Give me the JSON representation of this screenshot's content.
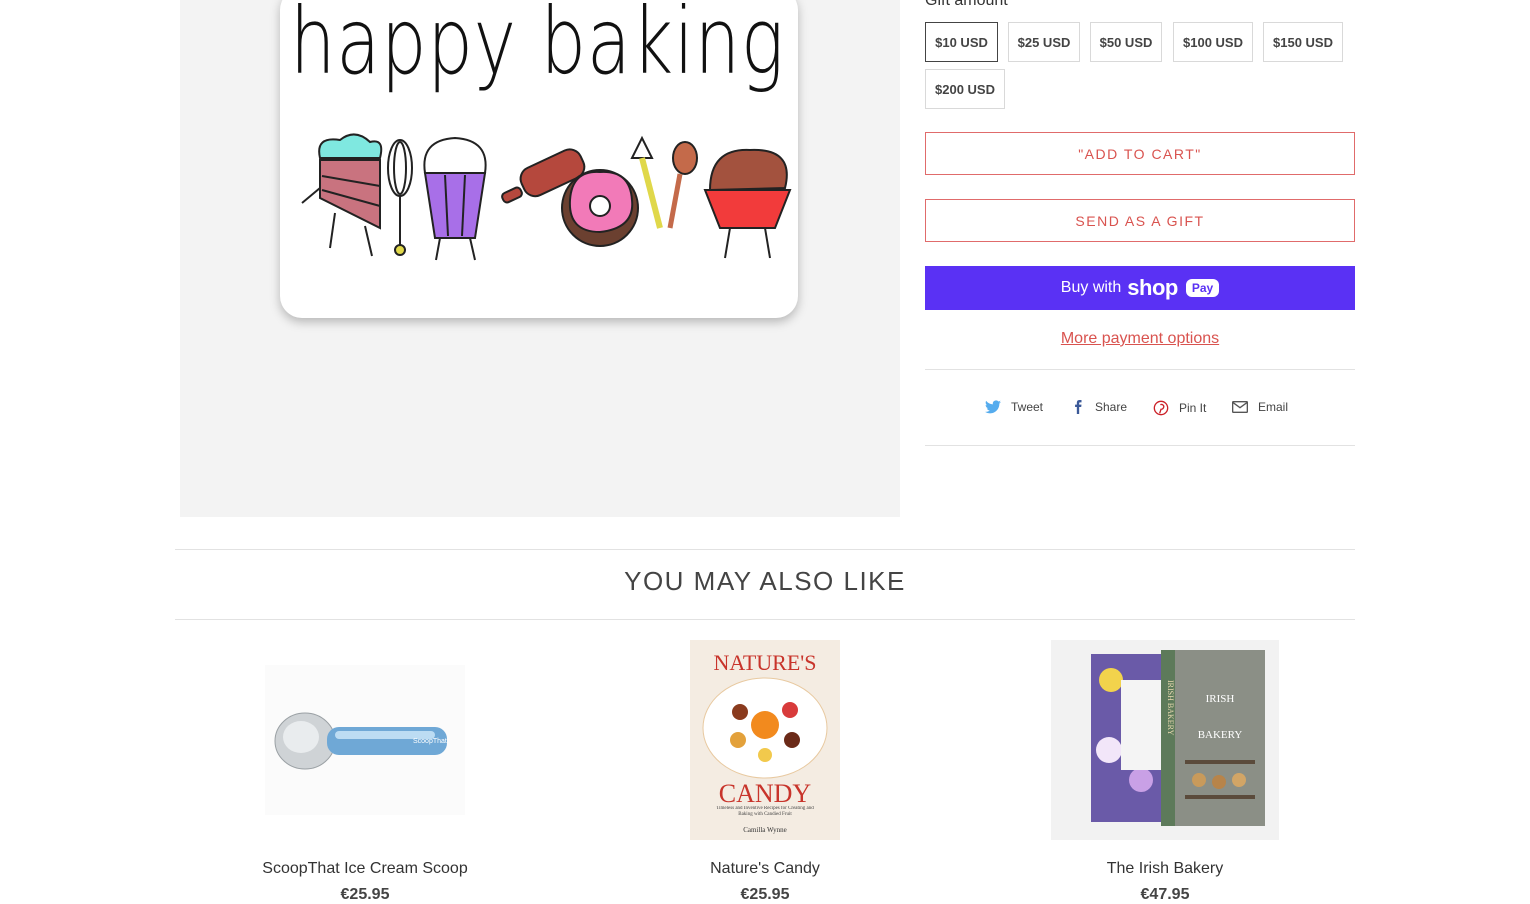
{
  "product_image": {
    "card_text": "happy baking"
  },
  "gift_amount": {
    "label": "Gift amount",
    "options": [
      "$10 USD",
      "$25 USD",
      "$50 USD",
      "$100 USD",
      "$150 USD",
      "$200 USD"
    ],
    "selected": "$10 USD"
  },
  "buttons": {
    "add_to_cart": "\"ADD TO CART\"",
    "send_as_gift": "SEND AS A GIFT",
    "buy_with": "Buy with",
    "shop_word": "shop",
    "pay_word": "Pay",
    "more_payment": "More payment options"
  },
  "social": {
    "tweet": "Tweet",
    "share": "Share",
    "pin": "Pin It",
    "email": "Email"
  },
  "related": {
    "title": "YOU MAY ALSO LIKE",
    "products": [
      {
        "name": "ScoopThat Ice Cream Scoop",
        "price": "€25.95",
        "image_text": "ScoopThat"
      },
      {
        "name": "Nature's Candy",
        "price": "€25.95",
        "image_title_top": "NATURE'S",
        "image_title_bottom": "CANDY",
        "image_subtitle": "Timeless and Inventive Recipes for Creating and Baking with Candied Fruit",
        "image_author": "Camilla Wynne"
      },
      {
        "name": "The Irish Bakery",
        "price": "€47.95",
        "image_title_top": "IRISH",
        "image_title_bottom": "BAKERY",
        "image_spine": "IRISH BAKERY"
      }
    ]
  },
  "colors": {
    "accent": "#d9534f",
    "shop_pay": "#5a31f4"
  }
}
